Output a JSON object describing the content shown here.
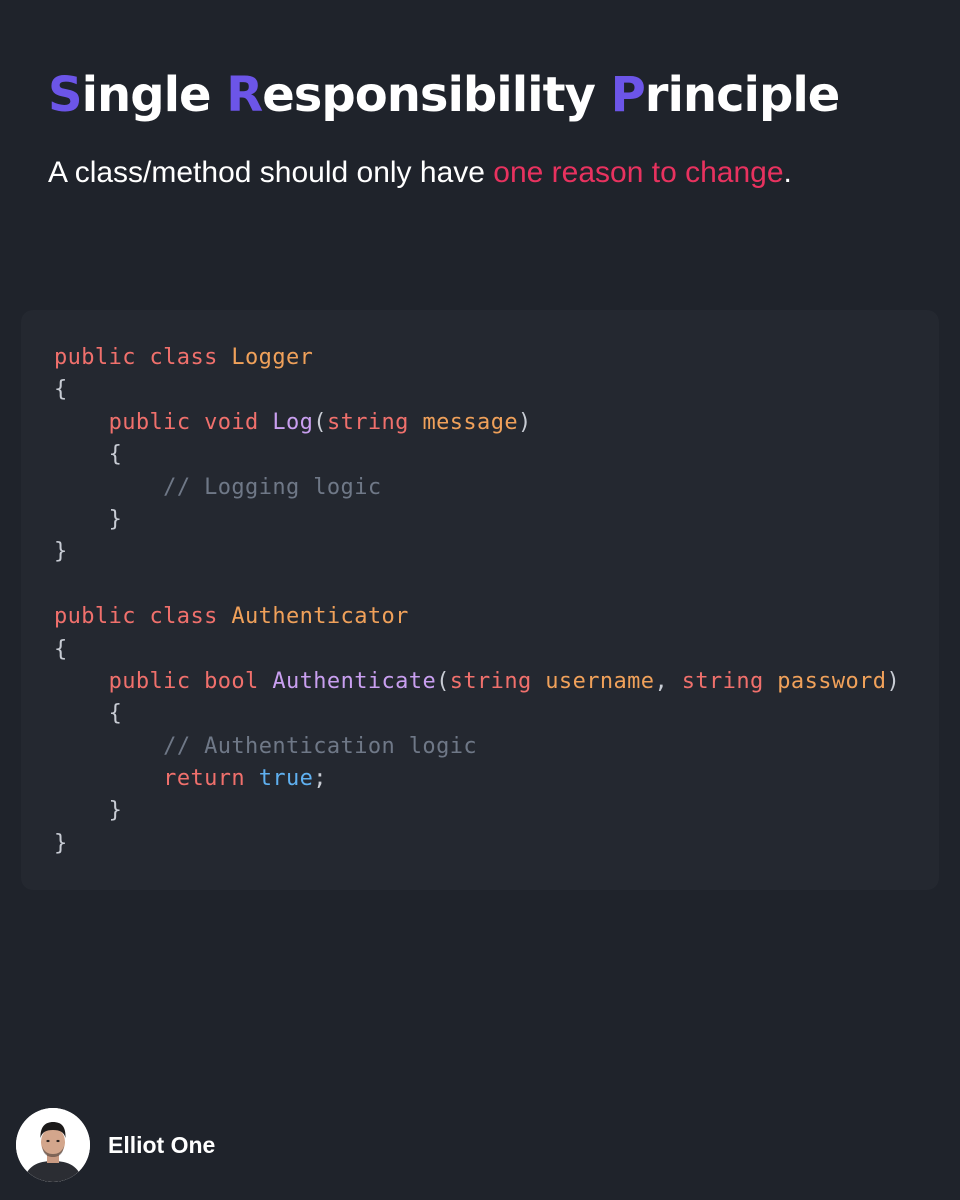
{
  "header": {
    "title": {
      "s_letter": "S",
      "s_rest": "ingle ",
      "r_letter": "R",
      "r_rest": "esponsibility ",
      "p_letter": "P",
      "p_rest": "rinciple"
    },
    "subtitle": {
      "prefix": "A class/method should only have ",
      "highlight": "one reason to change",
      "suffix": "."
    }
  },
  "code": {
    "l1": {
      "kw": "public class ",
      "type": "Logger"
    },
    "l2": {
      "punc": "{"
    },
    "l3": {
      "indent": "    ",
      "kw": "public void ",
      "fn": "Log",
      "open": "(",
      "ptype": "string ",
      "pname": "message",
      "close": ")"
    },
    "l4": {
      "indent": "    ",
      "punc": "{"
    },
    "l5": {
      "indent": "        ",
      "cmt": "// Logging logic"
    },
    "l6": {
      "indent": "    ",
      "punc": "}"
    },
    "l7": {
      "punc": "}"
    },
    "l8": {
      "kw": "public class ",
      "type": "Authenticator"
    },
    "l9": {
      "punc": "{"
    },
    "l10": {
      "indent": "    ",
      "kw": "public bool ",
      "fn": "Authenticate",
      "open": "(",
      "p1type": "string ",
      "p1name": "username",
      "comma": ", ",
      "p2type": "string ",
      "p2name": "password",
      "close": ")"
    },
    "l11": {
      "indent": "    ",
      "punc": "{"
    },
    "l12": {
      "indent": "        ",
      "cmt": "// Authentication logic"
    },
    "l13": {
      "indent": "        ",
      "kw": "return ",
      "lit": "true",
      "semi": ";"
    },
    "l14": {
      "indent": "    ",
      "punc": "}"
    },
    "l15": {
      "punc": "}"
    }
  },
  "author": {
    "name": "Elliot One",
    "avatar_icon": "person-avatar"
  },
  "colors": {
    "background": "#1f232b",
    "card": "#242830",
    "title_accent": "#6c55e8",
    "subtitle_highlight": "#e8325f",
    "keyword": "#f0706c",
    "type": "#f0a15a",
    "function": "#c99ff0",
    "comment": "#6f7887",
    "literal": "#5fb0f0"
  }
}
